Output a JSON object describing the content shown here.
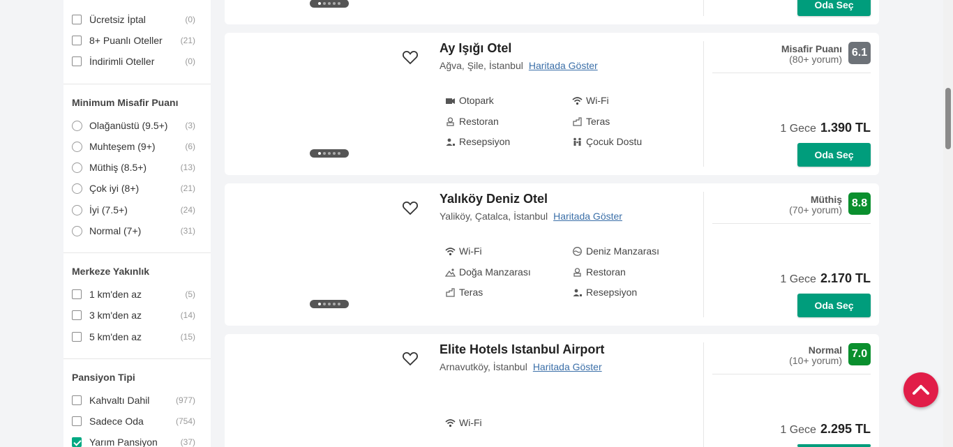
{
  "filters": {
    "top_items": [
      {
        "label": "Ücretsiz İptal",
        "count": "(0)"
      },
      {
        "label": "8+ Puanlı Oteller",
        "count": "(21)"
      },
      {
        "label": "İndirimli Oteller",
        "count": "(0)"
      }
    ],
    "guest_rating": {
      "title": "Minimum Misafir Puanı",
      "items": [
        {
          "label": "Olağanüstü (9.5+)",
          "count": "(3)"
        },
        {
          "label": "Muhteşem (9+)",
          "count": "(6)"
        },
        {
          "label": "Müthiş (8.5+)",
          "count": "(13)"
        },
        {
          "label": "Çok iyi (8+)",
          "count": "(21)"
        },
        {
          "label": "İyi (7.5+)",
          "count": "(24)"
        },
        {
          "label": "Normal (7+)",
          "count": "(31)"
        }
      ]
    },
    "distance": {
      "title": "Merkeze Yakınlık",
      "items": [
        {
          "label": "1 km'den az",
          "count": "(5)"
        },
        {
          "label": "3 km'den az",
          "count": "(14)"
        },
        {
          "label": "5 km'den az",
          "count": "(15)"
        }
      ]
    },
    "board": {
      "title": "Pansiyon Tipi",
      "items": [
        {
          "label": "Kahvaltı Dahil",
          "count": "(977)",
          "checked": false
        },
        {
          "label": "Sadece Oda",
          "count": "(754)",
          "checked": false
        },
        {
          "label": "Yarım Pansiyon",
          "count": "(37)",
          "checked": true
        }
      ]
    }
  },
  "hotels": [
    {
      "button": "Oda Seç"
    },
    {
      "name": "Ay Işığı Otel",
      "location": "Ağva, Şile, İstanbul",
      "map_link": "Haritada Göster",
      "rating_label": "Misafir Puanı",
      "reviews": "(80+ yorum)",
      "score": "6.1",
      "score_color": "#6d7278",
      "nights": "1 Gece",
      "price": "1.390 TL",
      "button": "Oda Seç",
      "amenities": [
        {
          "label": "Otopark",
          "icon": "parking-icon"
        },
        {
          "label": "Wi-Fi",
          "icon": "wifi-icon"
        },
        {
          "label": "Restoran",
          "icon": "restaurant-icon"
        },
        {
          "label": "Teras",
          "icon": "terrace-icon"
        },
        {
          "label": "Resepsiyon",
          "icon": "reception-icon"
        },
        {
          "label": "Çocuk Dostu",
          "icon": "family-icon"
        }
      ]
    },
    {
      "name": "Yalıköy Deniz Otel",
      "location": "Yaliköy, Çatalca, İstanbul",
      "map_link": "Haritada Göster",
      "rating_label": "Müthiş",
      "reviews": "(70+ yorum)",
      "score": "8.8",
      "score_color": "#0a8f2e",
      "nights": "1 Gece",
      "price": "2.170 TL",
      "button": "Oda Seç",
      "amenities": [
        {
          "label": "Wi-Fi",
          "icon": "wifi-icon"
        },
        {
          "label": "Deniz Manzarası",
          "icon": "sea-view-icon"
        },
        {
          "label": "Doğa Manzarası",
          "icon": "nature-view-icon"
        },
        {
          "label": "Restoran",
          "icon": "restaurant-icon"
        },
        {
          "label": "Teras",
          "icon": "terrace-icon"
        },
        {
          "label": "Resepsiyon",
          "icon": "reception-icon"
        }
      ]
    },
    {
      "name": "Elite Hotels Istanbul Airport",
      "location": "Arnavutköy, İstanbul",
      "map_link": "Haritada Göster",
      "rating_label": "Normal",
      "reviews": "(10+ yorum)",
      "score": "7.0",
      "score_color": "#0a8f2e",
      "nights": "1 Gece",
      "price": "2.295 TL",
      "amenities": [
        {
          "label": "Wi-Fi",
          "icon": "wifi-icon"
        }
      ]
    }
  ],
  "colors": {
    "accent": "#009d7c",
    "scroll_top": "#e11d48"
  }
}
